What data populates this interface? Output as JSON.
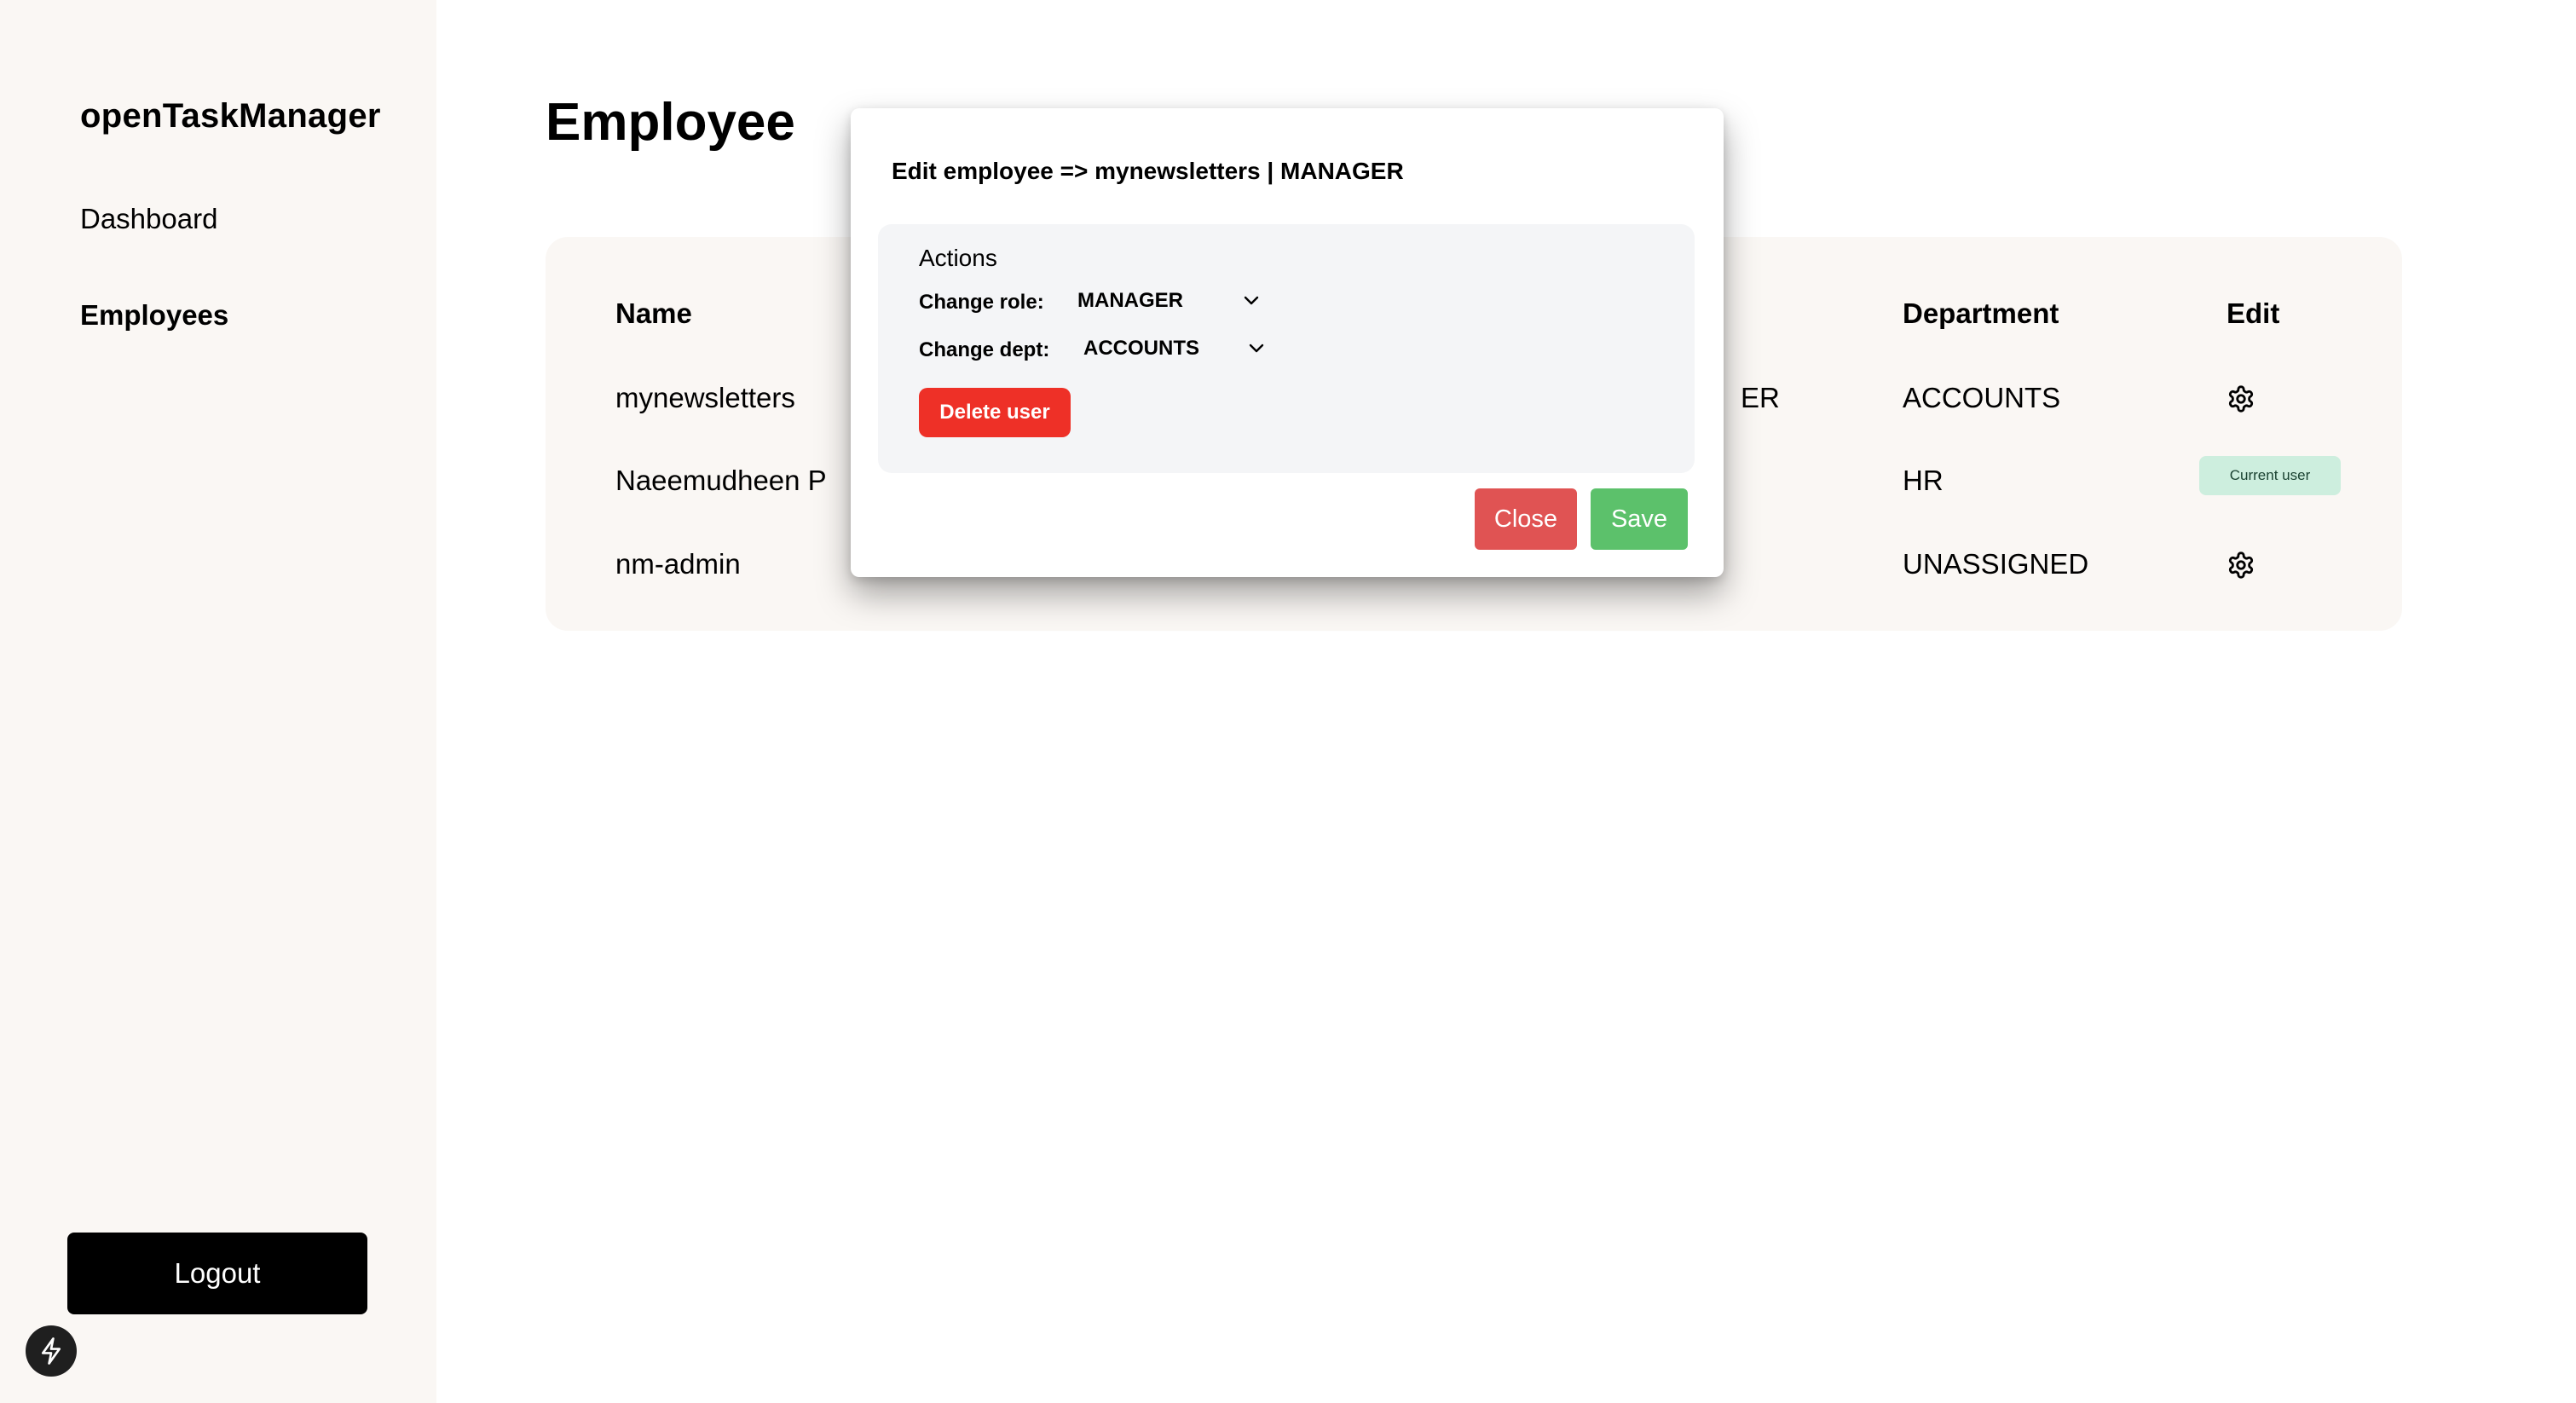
{
  "app": {
    "brand": "openTaskManager"
  },
  "sidebar": {
    "items": [
      {
        "label": "Dashboard",
        "active": false
      },
      {
        "label": "Employees",
        "active": true
      }
    ],
    "logout_label": "Logout"
  },
  "page": {
    "title": "Employee"
  },
  "table": {
    "headers": {
      "name": "Name",
      "department": "Department",
      "edit": "Edit"
    },
    "rows": [
      {
        "name": "mynewsletters",
        "role_visible": "ER",
        "department": "ACCOUNTS",
        "edit": "gear-icon"
      },
      {
        "name": "Naeemudheen P",
        "department": "HR",
        "edit_badge": "Current user"
      },
      {
        "name": "nm-admin",
        "department": "UNASSIGNED",
        "edit": "gear-icon"
      }
    ]
  },
  "modal": {
    "title": "Edit employee => mynewsletters | MANAGER",
    "actions_label": "Actions",
    "role_label": "Change role:",
    "role_value": "MANAGER",
    "dept_label": "Change dept:",
    "dept_value": "ACCOUNTS",
    "delete_label": "Delete user",
    "close_label": "Close",
    "save_label": "Save"
  },
  "colors": {
    "sidebar_bg": "#faf7f4",
    "card_bg": "#faf7f4",
    "delete": "#ee3027",
    "close": "#e05353",
    "save": "#5cc16b",
    "badge_bg": "#cdeede"
  }
}
